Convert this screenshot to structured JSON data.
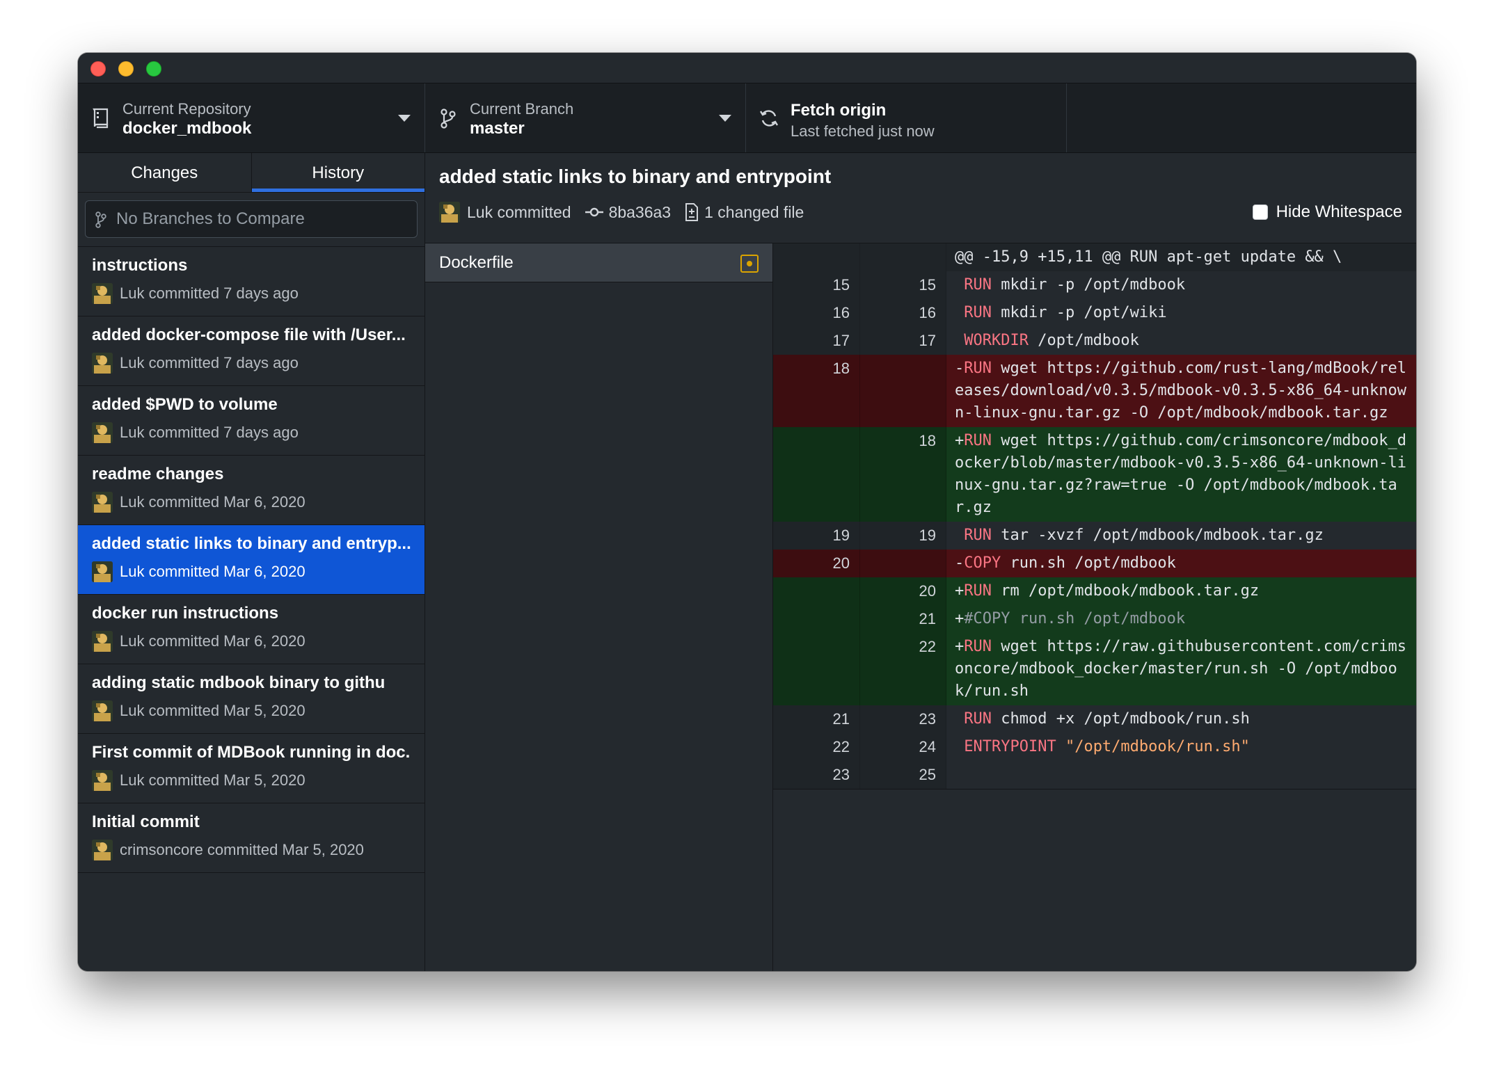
{
  "toolbar": {
    "repo_label": "Current Repository",
    "repo_value": "docker_mdbook",
    "branch_label": "Current Branch",
    "branch_value": "master",
    "fetch_label": "Fetch origin",
    "fetch_sub": "Last fetched just now"
  },
  "sidebar": {
    "tabs": [
      "Changes",
      "History"
    ],
    "active_tab": "History",
    "compare_placeholder": "No Branches to Compare",
    "commits": [
      {
        "title": "instructions",
        "meta": "Luk committed 7 days ago"
      },
      {
        "title": "added docker-compose file with /User...",
        "meta": "Luk committed 7 days ago"
      },
      {
        "title": "added $PWD to volume",
        "meta": "Luk committed 7 days ago"
      },
      {
        "title": "readme changes",
        "meta": "Luk committed Mar 6, 2020"
      },
      {
        "title": "added static links to binary and entryp...",
        "meta": "Luk committed Mar 6, 2020",
        "selected": true
      },
      {
        "title": "docker run instructions",
        "meta": "Luk committed Mar 6, 2020"
      },
      {
        "title": "adding static mdbook binary to githu",
        "meta": "Luk committed Mar 5, 2020"
      },
      {
        "title": "First commit of MDBook running in doc...",
        "meta": "Luk committed Mar 5, 2020"
      },
      {
        "title": "Initial commit",
        "meta": "crimsoncore committed Mar 5, 2020"
      }
    ]
  },
  "commit_detail": {
    "title": "added static links to binary and entrypoint",
    "author": "Luk committed",
    "sha": "8ba36a3",
    "changed_files": "1 changed file",
    "hide_whitespace_label": "Hide Whitespace"
  },
  "files": [
    {
      "name": "Dockerfile",
      "status": "modified"
    }
  ],
  "diff": {
    "hunk": "@@ -15,9 +15,11 @@ RUN apt-get update && \\",
    "lines": [
      {
        "type": "ctx",
        "old": "15",
        "new": "15",
        "prefix": " ",
        "kw": "RUN",
        "rest": " mkdir -p /opt/mdbook"
      },
      {
        "type": "ctx",
        "old": "16",
        "new": "16",
        "prefix": " ",
        "kw": "RUN",
        "rest": " mkdir -p /opt/wiki"
      },
      {
        "type": "ctx",
        "old": "17",
        "new": "17",
        "prefix": " ",
        "kw": "WORKDIR",
        "rest": " /opt/mdbook"
      },
      {
        "type": "del",
        "old": "18",
        "new": "",
        "prefix": "-",
        "kw": "RUN",
        "rest": " wget https://github.com/rust-lang/mdBook/releases/download/v0.3.5/mdbook-v0.3.5-x86_64-unknown-linux-gnu.tar.gz -O /opt/mdbook/mdbook.tar.gz"
      },
      {
        "type": "add",
        "old": "",
        "new": "18",
        "prefix": "+",
        "kw": "RUN",
        "rest": " wget https://github.com/crimsoncore/mdbook_docker/blob/master/mdbook-v0.3.5-x86_64-unknown-linux-gnu.tar.gz?raw=true -O /opt/mdbook/mdbook.tar.gz"
      },
      {
        "type": "ctx",
        "old": "19",
        "new": "19",
        "prefix": " ",
        "kw": "RUN",
        "rest": " tar -xvzf /opt/mdbook/mdbook.tar.gz"
      },
      {
        "type": "del",
        "old": "20",
        "new": "",
        "prefix": "-",
        "kw": "COPY",
        "rest": " run.sh /opt/mdbook"
      },
      {
        "type": "add",
        "old": "",
        "new": "20",
        "prefix": "+",
        "kw": "RUN",
        "rest": " rm /opt/mdbook/mdbook.tar.gz"
      },
      {
        "type": "add",
        "old": "",
        "new": "21",
        "prefix": "+",
        "kw": "",
        "rest": "#COPY run.sh /opt/mdbook",
        "comment": true
      },
      {
        "type": "add",
        "old": "",
        "new": "22",
        "prefix": "+",
        "kw": "RUN",
        "rest": " wget https://raw.githubusercontent.com/crimsoncore/mdbook_docker/master/run.sh -O /opt/mdbook/run.sh"
      },
      {
        "type": "ctx",
        "old": "21",
        "new": "23",
        "prefix": " ",
        "kw": "RUN",
        "rest": " chmod +x /opt/mdbook/run.sh"
      },
      {
        "type": "ctx",
        "old": "22",
        "new": "24",
        "prefix": " ",
        "kw": "ENTRYPOINT",
        "rest": " ",
        "str": "\"/opt/mdbook/run.sh\""
      },
      {
        "type": "ctx",
        "old": "23",
        "new": "25",
        "prefix": " ",
        "kw": "",
        "rest": ""
      }
    ]
  },
  "colors": {
    "accent": "#0f56d6",
    "deleted_bg": "#4c1014",
    "added_bg": "#133b1c",
    "keyword": "#f97583",
    "modified_badge": "#dba400"
  }
}
